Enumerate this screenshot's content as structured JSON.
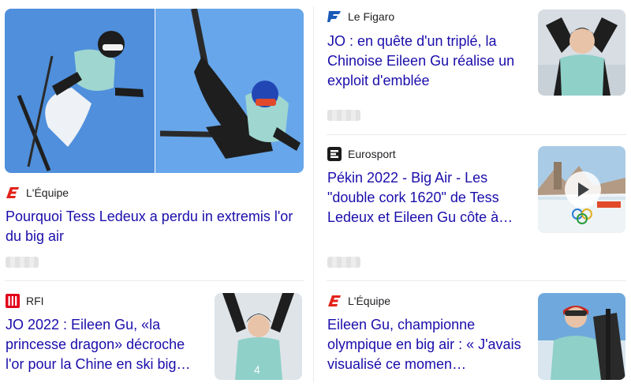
{
  "cards": [
    {
      "source": "L'Équipe",
      "title": "Pourquoi Tess Ledeux a perdu in extremis l'or du big air",
      "logo_icon": "lequipe-logo-icon",
      "image": "skiers-big-air-jump-image"
    },
    {
      "source": "Le Figaro",
      "title": "JO : en quête d'un triplé, la Chinoise Eileen Gu réalise un exploit d'emblée",
      "logo_icon": "lefigaro-logo-icon",
      "image": "eileen-gu-celebrating-image"
    },
    {
      "source": "Eurosport",
      "title": "Pékin 2022 - Big Air - Les \"double cork 1620\" de Tess Ledeux et Eileen Gu côte à…",
      "logo_icon": "eurosport-logo-icon",
      "image": "big-air-video-thumbnail",
      "has_video": true
    },
    {
      "source": "RFI",
      "title": "JO 2022 : Eileen Gu, «la princesse dragon» décroche l'or pour la Chine en ski big…",
      "logo_icon": "rfi-logo-icon",
      "image": "eileen-gu-arms-raised-image"
    },
    {
      "source": "L'Équipe",
      "title": "Eileen Gu, championne olympique en big air : « J'avais visualisé ce momen…",
      "logo_icon": "lequipe-logo-icon",
      "image": "eileen-gu-with-skis-image"
    }
  ],
  "colors": {
    "headline": "#1a0dab",
    "lequipe_red": "#e2231a",
    "figaro_blue": "#1a5ab8",
    "rfi_red": "#e2001a",
    "sky_blue": "#5e9be0"
  }
}
